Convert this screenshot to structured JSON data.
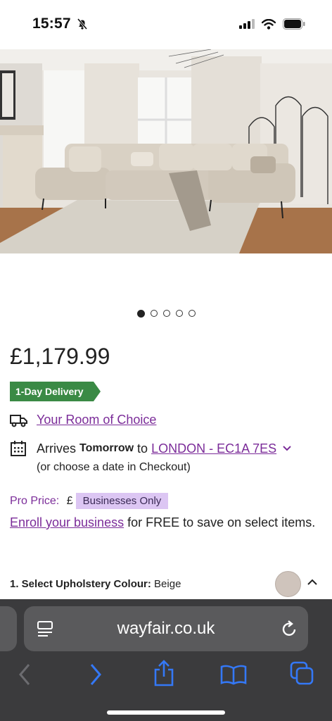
{
  "status": {
    "time": "15:57"
  },
  "gallery": {
    "dot_count": 5,
    "active_index": 0
  },
  "product": {
    "price": "£1,179.99",
    "delivery_badge": "1-Day Delivery",
    "room_link": "Your Room of Choice",
    "arrives_prefix": "Arrives ",
    "arrives_day": "Tomorrow",
    "arrives_to": " to ",
    "location_link": "LONDON - EC1A 7ES",
    "checkout_note": "(or choose a date in Checkout)",
    "pro_label": "Pro Price: ",
    "pro_currency": "£",
    "pro_tag": "Businesses Only",
    "enroll_link": "Enroll your business",
    "enroll_rest": " for FREE to save on select items.",
    "select_label": "1. Select Upholstery Colour: ",
    "select_value": "Beige"
  },
  "browser": {
    "url": "wayfair.co.uk"
  },
  "colors": {
    "accent_purple": "#7b2c99",
    "badge_green": "#3a8a45",
    "browser_bg": "#3b3b3d",
    "toolbar_blue": "#3478f6"
  }
}
